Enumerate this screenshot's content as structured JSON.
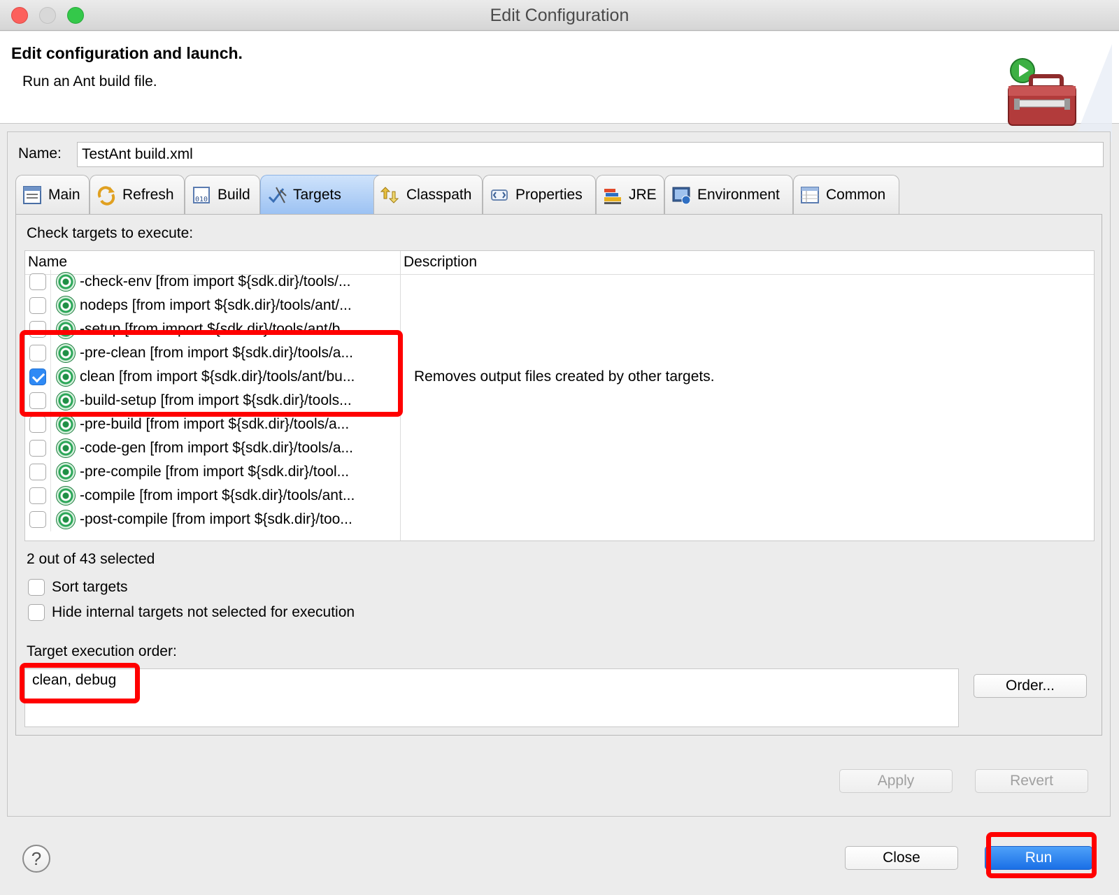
{
  "window": {
    "title": "Edit Configuration"
  },
  "header": {
    "title": "Edit configuration and launch.",
    "subtitle": "Run an Ant build file."
  },
  "name_field": {
    "label": "Name:",
    "value": "TestAnt build.xml"
  },
  "tabs": [
    {
      "label": "Main",
      "icon": "main-tab-icon"
    },
    {
      "label": "Refresh",
      "icon": "refresh-icon"
    },
    {
      "label": "Build",
      "icon": "build-icon"
    },
    {
      "label": "Targets",
      "icon": "targets-icon",
      "active": true
    },
    {
      "label": "Classpath",
      "icon": "classpath-icon"
    },
    {
      "label": "Properties",
      "icon": "properties-icon"
    },
    {
      "label": "JRE",
      "icon": "jre-icon"
    },
    {
      "label": "Environment",
      "icon": "environment-icon"
    },
    {
      "label": "Common",
      "icon": "common-icon"
    }
  ],
  "targets_panel": {
    "prompt": "Check targets to execute:",
    "columns": [
      "Name",
      "Description"
    ],
    "rows": [
      {
        "name": "-check-env [from import ${sdk.dir}/tools/...",
        "description": "",
        "checked": false
      },
      {
        "name": "nodeps [from import ${sdk.dir}/tools/ant/...",
        "description": "",
        "checked": false
      },
      {
        "name": "-setup [from import ${sdk.dir}/tools/ant/b...",
        "description": "",
        "checked": false
      },
      {
        "name": "-pre-clean [from import ${sdk.dir}/tools/a...",
        "description": "",
        "checked": false
      },
      {
        "name": "clean [from import ${sdk.dir}/tools/ant/bu...",
        "description": "Removes output files created by other targets.",
        "checked": true
      },
      {
        "name": "-build-setup [from import ${sdk.dir}/tools...",
        "description": "",
        "checked": false
      },
      {
        "name": "-pre-build [from import ${sdk.dir}/tools/a...",
        "description": "",
        "checked": false
      },
      {
        "name": "-code-gen [from import ${sdk.dir}/tools/a...",
        "description": "",
        "checked": false
      },
      {
        "name": "-pre-compile [from import ${sdk.dir}/tool...",
        "description": "",
        "checked": false
      },
      {
        "name": "-compile [from import ${sdk.dir}/tools/ant...",
        "description": "",
        "checked": false
      },
      {
        "name": "-post-compile [from import ${sdk.dir}/too...",
        "description": "",
        "checked": false
      }
    ],
    "selected_count": "2 out of 43 selected",
    "sort_targets": "Sort targets",
    "hide_internal": "Hide internal targets not selected for execution",
    "order_label": "Target execution order:",
    "order_value": "clean, debug",
    "order_button": "Order..."
  },
  "buttons": {
    "apply": "Apply",
    "revert": "Revert",
    "close": "Close",
    "run": "Run",
    "help": "?"
  },
  "colors": {
    "highlight": "#ff0000",
    "run_button": "#1a6fe6"
  }
}
